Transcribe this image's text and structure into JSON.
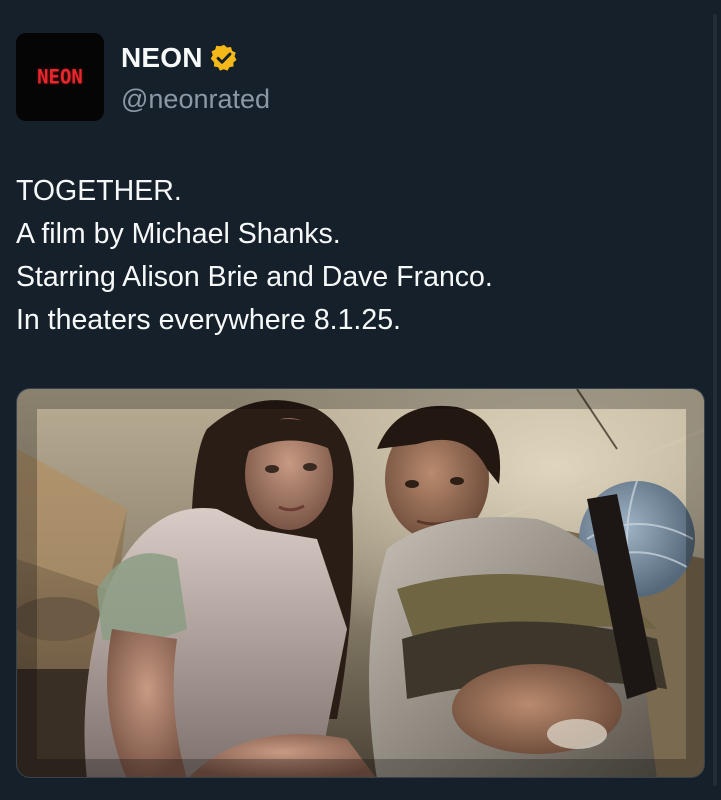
{
  "account": {
    "avatar_text": "NEON",
    "display_name": "NEON",
    "handle": "@neonrated",
    "verified_badge_icon": "verified-badge-icon",
    "verified_color": "#f5b819"
  },
  "tweet": {
    "lines": [
      "TOGETHER.",
      "A film by Michael Shanks.",
      "Starring Alison Brie and Dave Franco.",
      "In theaters everywhere 8.1.25."
    ]
  },
  "media": {
    "type": "photo",
    "description_icon": "film-still-image"
  },
  "colors": {
    "background": "#15202b",
    "text": "#f7f9f9",
    "secondary_text": "#8b98a5",
    "brand_red": "#e8262b"
  }
}
